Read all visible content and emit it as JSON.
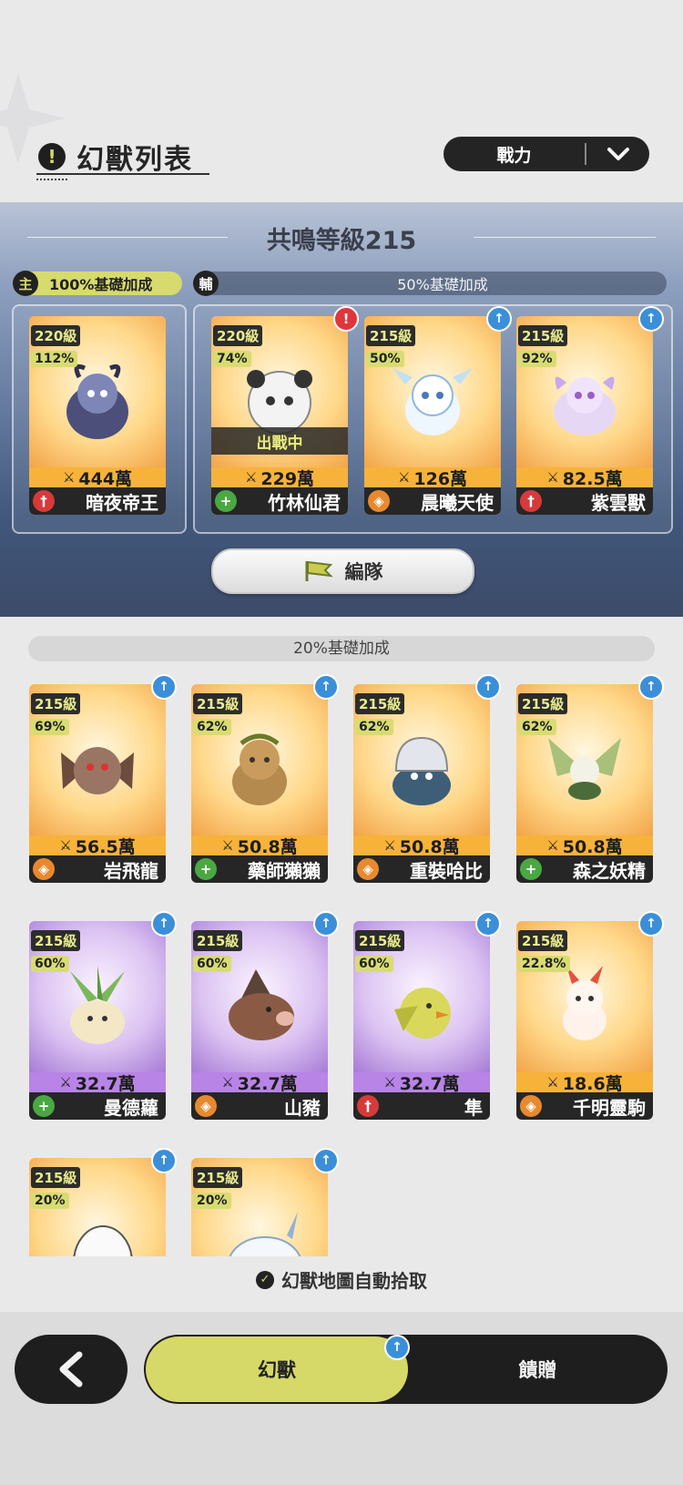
{
  "header": {
    "title": "幻獸列表",
    "title_icon": "alert-icon",
    "sort_label": "戰力",
    "sort_icon": "chevron-down-icon"
  },
  "resonance": {
    "title": "共鳴等級215",
    "main_tag": "主",
    "main_bonus": "100%基礎加成",
    "sub_tag": "輔",
    "sub_bonus": "50%基礎加成",
    "team_button": "編隊"
  },
  "main_card": {
    "level": "220級",
    "percent": "112%",
    "power": "444萬",
    "name": "暗夜帝王",
    "role": "attack",
    "frame": "gold"
  },
  "sub_cards": [
    {
      "level": "220級",
      "percent": "74%",
      "power": "229萬",
      "name": "竹林仙君",
      "role": "heal",
      "frame": "gold",
      "status": "出戰中",
      "badge": "alert"
    },
    {
      "level": "215級",
      "percent": "50%",
      "power": "126萬",
      "name": "晨曦天使",
      "role": "defense",
      "frame": "gold",
      "badge": "upgrade"
    },
    {
      "level": "215級",
      "percent": "92%",
      "power": "82.5萬",
      "name": "紫雲獸",
      "role": "attack",
      "frame": "gold",
      "badge": "upgrade"
    }
  ],
  "tier": {
    "bonus": "20%基礎加成"
  },
  "list_cards": [
    {
      "level": "215級",
      "percent": "69%",
      "power": "56.5萬",
      "name": "岩飛龍",
      "role": "defense",
      "frame": "gold"
    },
    {
      "level": "215級",
      "percent": "62%",
      "power": "50.8萬",
      "name": "藥師獺獺",
      "role": "heal",
      "frame": "gold"
    },
    {
      "level": "215級",
      "percent": "62%",
      "power": "50.8萬",
      "name": "重裝哈比",
      "role": "defense",
      "frame": "gold"
    },
    {
      "level": "215級",
      "percent": "62%",
      "power": "50.8萬",
      "name": "森之妖精",
      "role": "heal",
      "frame": "gold"
    },
    {
      "level": "215級",
      "percent": "60%",
      "power": "32.7萬",
      "name": "曼德蘿",
      "role": "heal",
      "frame": "purple"
    },
    {
      "level": "215級",
      "percent": "60%",
      "power": "32.7萬",
      "name": "山豬",
      "role": "defense",
      "frame": "purple"
    },
    {
      "level": "215級",
      "percent": "60%",
      "power": "32.7萬",
      "name": "隼",
      "role": "attack",
      "frame": "purple"
    },
    {
      "level": "215級",
      "percent": "22.8%",
      "power": "18.6萬",
      "name": "千明靈駒",
      "role": "defense",
      "frame": "gold"
    },
    {
      "level": "215級",
      "percent": "20%",
      "power": "",
      "name": "",
      "role": "",
      "frame": "gold"
    },
    {
      "level": "215級",
      "percent": "20%",
      "power": "",
      "name": "",
      "role": "",
      "frame": "gold"
    }
  ],
  "auto_pickup": "幻獸地圖自動拾取",
  "bottom_nav": {
    "back_icon": "back-arrow-icon",
    "tab_active": "幻獸",
    "tab_inactive": "饋贈"
  },
  "colors": {
    "accent": "#d6d967",
    "upgrade_badge": "#3a8fd8",
    "alert_badge": "#e0353d",
    "role_attack": "#d63a3a",
    "role_heal": "#4aa843",
    "role_defense": "#e8892f"
  }
}
